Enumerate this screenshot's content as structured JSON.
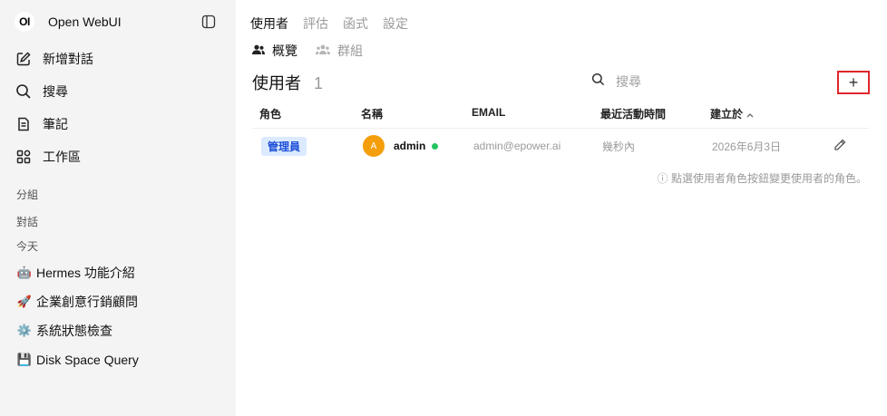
{
  "app": {
    "logo": "OI",
    "name": "Open WebUI"
  },
  "sidebar": {
    "toggle_icon": "sidebar-panel-icon",
    "nav": [
      {
        "label": "新增對話",
        "icon": "edit-icon"
      },
      {
        "label": "搜尋",
        "icon": "search-icon"
      },
      {
        "label": "筆記",
        "icon": "note-icon"
      },
      {
        "label": "工作區",
        "icon": "workspace-icon"
      }
    ],
    "sections": {
      "groups": "分組",
      "chats": "對話",
      "today": "今天"
    },
    "chats": [
      {
        "emoji": "🤖",
        "title": "Hermes 功能介紹"
      },
      {
        "emoji": "🚀",
        "title": "企業創意行銷顧問"
      },
      {
        "emoji": "⚙️",
        "title": "系統狀態檢查"
      },
      {
        "emoji": "💾",
        "title": "Disk Space Query"
      }
    ]
  },
  "main": {
    "tabs": [
      "使用者",
      "評估",
      "函式",
      "設定"
    ],
    "subtabs": [
      {
        "label": "概覽",
        "icon": "users-icon"
      },
      {
        "label": "群組",
        "icon": "group-icon"
      }
    ],
    "heading": {
      "title": "使用者",
      "count": "1"
    },
    "search": {
      "placeholder": "搜尋"
    },
    "add_label": "+",
    "table": {
      "columns": [
        "角色",
        "名稱",
        "EMAIL",
        "最近活動時間",
        "建立於"
      ],
      "sort_indicator": "^",
      "rows": [
        {
          "role": "管理員",
          "avatar": "A",
          "name": "admin",
          "email": "admin@epower.ai",
          "last_active": "幾秒內",
          "created": "2026年6月3日"
        }
      ]
    },
    "hint": "ⓘ 點選使用者角色按鈕變更使用者的角色。"
  },
  "colors": {
    "accent_red": "#e0262b",
    "badge_bg": "#dbeafe",
    "badge_text": "#1d4ed8",
    "avatar": "#f59e0b",
    "online": "#22c55e"
  }
}
